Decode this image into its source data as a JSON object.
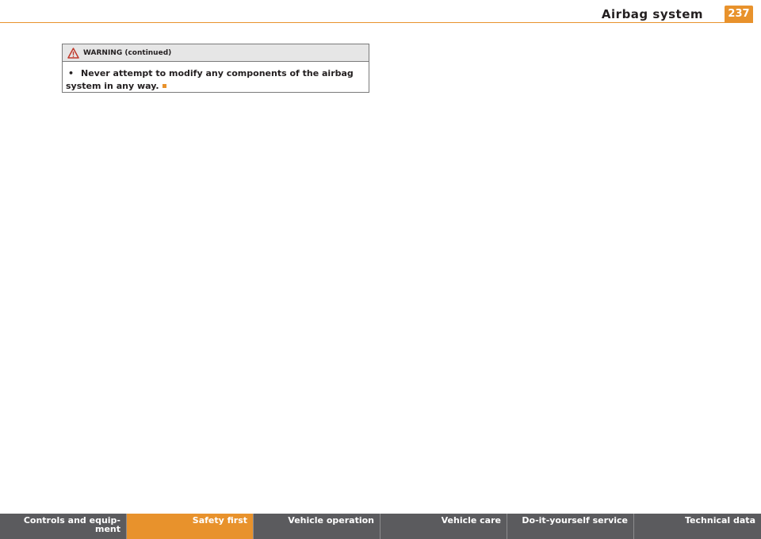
{
  "header": {
    "title": "Airbag system",
    "page_number": "237"
  },
  "warning": {
    "title": "WARNING (continued)",
    "bullet": "•",
    "text": "Never attempt to modify any components of the airbag system in any way."
  },
  "nav": {
    "tabs": [
      {
        "label": "Controls and equip-\nment",
        "active": false
      },
      {
        "label": "Safety first",
        "active": true
      },
      {
        "label": "Vehicle operation",
        "active": false
      },
      {
        "label": "Vehicle care",
        "active": false
      },
      {
        "label": "Do-it-yourself service",
        "active": false
      },
      {
        "label": "Technical data",
        "active": false
      }
    ]
  },
  "colors": {
    "accent": "#e8922c",
    "nav_background": "#5b5b5e",
    "warning_icon": "#c0392b"
  }
}
